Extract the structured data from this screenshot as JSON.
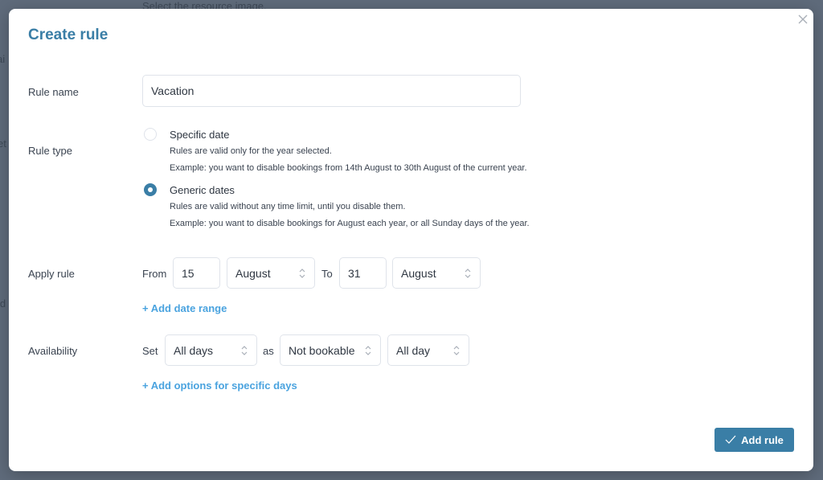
{
  "background": {
    "top_text": "Select the resource image.",
    "left_fragments": [
      "ai",
      "et",
      "ld"
    ]
  },
  "modal": {
    "title": "Create rule",
    "close_icon": "close-icon"
  },
  "rule_name": {
    "label": "Rule name",
    "value": "Vacation"
  },
  "rule_type": {
    "label": "Rule type",
    "selected": "generic",
    "options": [
      {
        "title": "Specific date",
        "desc1": "Rules are valid only for the year selected.",
        "desc2": "Example: you want to disable bookings from 14th August to 30th August of the current year.",
        "checked": false
      },
      {
        "title": "Generic dates",
        "desc1": "Rules are valid without any time limit, until you disable them.",
        "desc2": "Example: you want to disable bookings for August each year, or all Sunday days of the year.",
        "checked": true
      }
    ]
  },
  "apply_rule": {
    "label": "Apply rule",
    "from_label": "From",
    "from_day": "15",
    "from_month": "August",
    "to_label": "To",
    "to_day": "31",
    "to_month": "August",
    "add_link": "+ Add date range"
  },
  "availability": {
    "label": "Availability",
    "set_label": "Set",
    "days": "All days",
    "as_label": "as",
    "status": "Not bookable",
    "time": "All day",
    "add_link": "+ Add options for specific days"
  },
  "footer": {
    "submit_label": "Add rule",
    "submit_icon": "check-icon"
  },
  "colors": {
    "accent": "#3a7ea6",
    "link": "#4aa3df",
    "overlay": "#5f6b7b"
  }
}
